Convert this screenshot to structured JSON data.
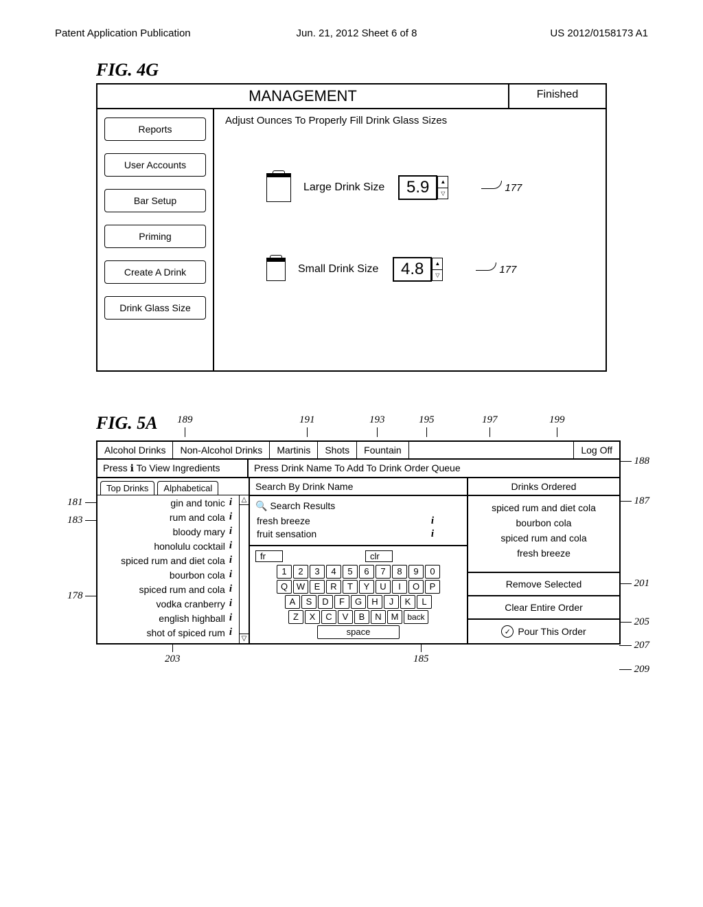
{
  "header": {
    "left": "Patent Application Publication",
    "center": "Jun. 21, 2012  Sheet 6 of 8",
    "right": "US 2012/0158173 A1"
  },
  "fig4g": {
    "label": "FIG. 4G",
    "title": "MANAGEMENT",
    "finished": "Finished",
    "instruction": "Adjust Ounces To Properly Fill Drink Glass Sizes",
    "sidebar": [
      "Reports",
      "User Accounts",
      "Bar Setup",
      "Priming",
      "Create A Drink",
      "Drink Glass Size"
    ],
    "large": {
      "label": "Large Drink Size",
      "value": "5.9",
      "callout": "177"
    },
    "small": {
      "label": "Small Drink Size",
      "value": "4.8",
      "callout": "177"
    }
  },
  "fig5a": {
    "label": "FIG. 5A",
    "callouts_top": {
      "c189": "189",
      "c191": "191",
      "c193": "193",
      "c195": "195",
      "c197": "197",
      "c199": "199"
    },
    "tabs": [
      "Alcohol Drinks",
      "Non-Alcohol Drinks",
      "Martinis",
      "Shots",
      "Fountain",
      "Log Off"
    ],
    "sub_left": "Press ℹ To View Ingredients",
    "sub_right": "Press Drink Name To Add To Drink Order Queue",
    "list_tabs": [
      "Top Drinks",
      "Alphabetical"
    ],
    "drinks": [
      "gin and tonic",
      "rum and cola",
      "bloody mary",
      "honolulu cocktail",
      "spiced rum and diet cola",
      "bourbon cola",
      "spiced rum and cola",
      "vodka cranberry",
      "english highball",
      "shot of spiced rum"
    ],
    "search_head": "Search By Drink Name",
    "search_title": "Search Results",
    "search_results": [
      "fresh breeze",
      "fruit sensation"
    ],
    "kb_input": "fr",
    "kb_clear": "clr",
    "kb_back": "back",
    "kb_space": "space",
    "kb_r1": [
      "1",
      "2",
      "3",
      "4",
      "5",
      "6",
      "7",
      "8",
      "9",
      "0"
    ],
    "kb_r2": [
      "Q",
      "W",
      "E",
      "R",
      "T",
      "Y",
      "U",
      "I",
      "O",
      "P"
    ],
    "kb_r3": [
      "A",
      "S",
      "D",
      "F",
      "G",
      "H",
      "J",
      "K",
      "L"
    ],
    "kb_r4": [
      "Z",
      "X",
      "C",
      "V",
      "B",
      "N",
      "M"
    ],
    "orders_head": "Drinks Ordered",
    "orders": [
      "spiced rum and diet cola",
      "bourbon cola",
      "spiced rum and cola",
      "fresh breeze"
    ],
    "btn_remove": "Remove Selected",
    "btn_clear": "Clear Entire Order",
    "btn_pour": "Pour This Order",
    "callouts": {
      "c188": "188",
      "c187": "187",
      "c201": "201",
      "c205": "205",
      "c207": "207",
      "c209": "209",
      "c181": "181",
      "c183": "183",
      "c178": "178",
      "c203": "203",
      "c185": "185"
    }
  }
}
